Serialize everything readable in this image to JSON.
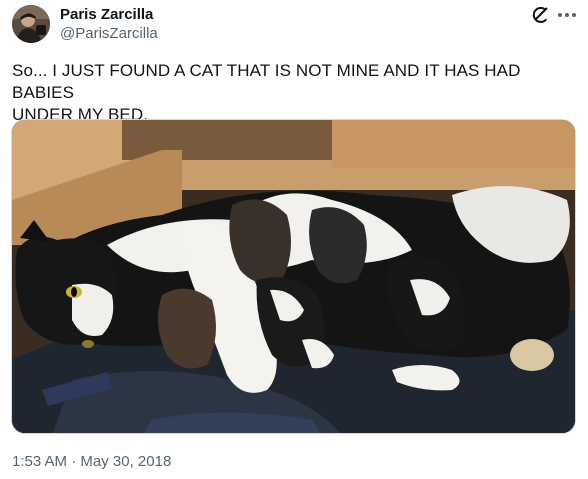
{
  "author": {
    "display_name": "Paris Zarcilla",
    "handle": "@ParisZarcilla"
  },
  "tweet": {
    "text_line1": "So... I JUST FOUND A CAT THAT IS NOT MINE AND IT HAS HAD BABIES",
    "text_line2": "UNDER MY BED.",
    "time": "1:53 AM",
    "separator": " · ",
    "date": "May 30, 2018"
  },
  "icons": {
    "grok": "grok-icon",
    "more": "more-icon"
  },
  "colors": {
    "text_primary": "#0f1419",
    "text_secondary": "#536471",
    "border": "#cfd9de"
  }
}
